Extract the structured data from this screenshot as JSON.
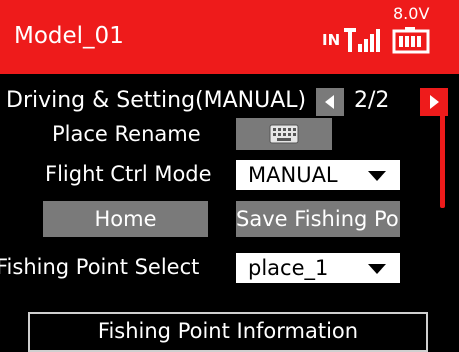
{
  "header": {
    "title": "Model_01",
    "input_label": "IN",
    "voltage": "8.0V",
    "signal_icon": "signal-bars-icon",
    "battery_icon": "battery-icon",
    "color": "#ee1b1b"
  },
  "nav": {
    "title": "Driving & Setting(MANUAL)",
    "page": "2/2",
    "prev_icon": "arrow-left-icon",
    "next_icon": "arrow-right-icon"
  },
  "rows": {
    "place_rename_label": "Place Rename",
    "keyboard_icon": "keyboard-icon",
    "flight_mode_label": "Flight Ctrl Mode",
    "flight_mode_value": "MANUAL",
    "home_button": "Home",
    "save_button": "Save Fishing Poi",
    "fishing_point_label": "Fishing Point Select",
    "fishing_point_value": "place_1",
    "info_title": "Fishing Point Information"
  }
}
